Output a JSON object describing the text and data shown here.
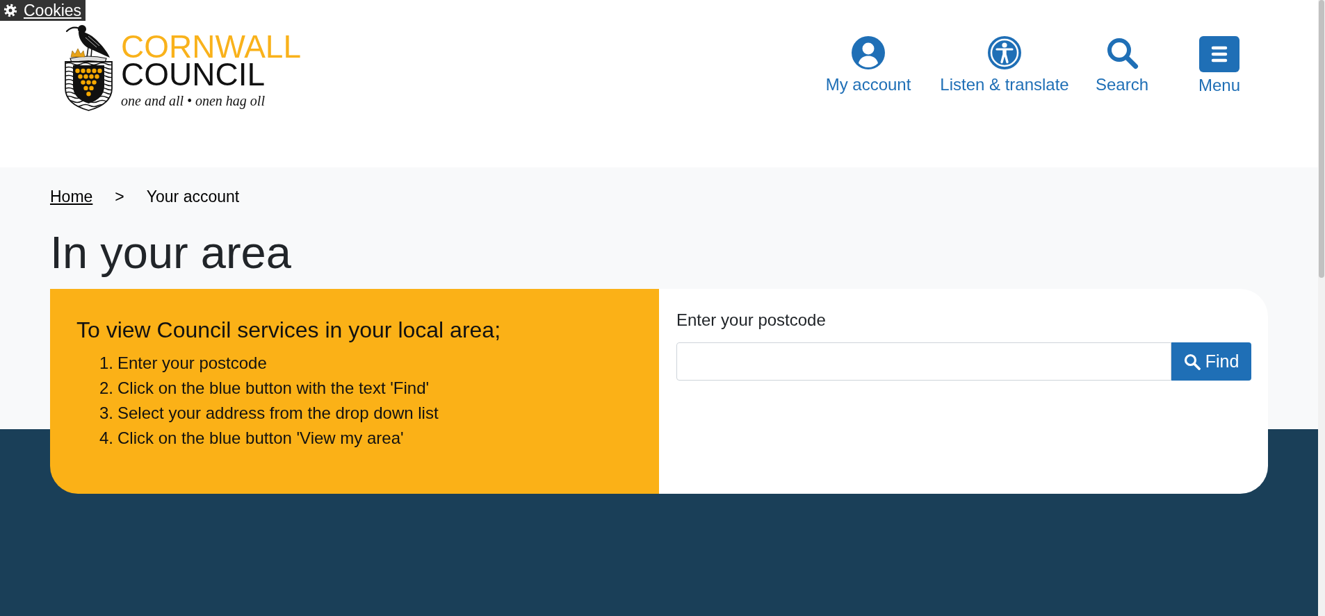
{
  "cookie_button": {
    "label": "Cookies"
  },
  "logo": {
    "line_1": "CORNWALL",
    "line_2": "COUNCIL",
    "motto": "one and all • onen hag oll"
  },
  "header_nav": [
    {
      "kind": "account",
      "label": "My account"
    },
    {
      "kind": "accessibility",
      "label": "Listen & translate"
    },
    {
      "kind": "search",
      "label": "Search"
    },
    {
      "kind": "menu",
      "label": "Menu"
    }
  ],
  "breadcrumb": {
    "separator": ">",
    "items": [
      {
        "label": "Home",
        "current": false
      },
      {
        "label": "Your account",
        "current": true
      }
    ]
  },
  "page_title": "In your area",
  "instructions": {
    "title": "To view Council services in your local area;",
    "steps": [
      {
        "number": "1.",
        "text": "Enter your postcode"
      },
      {
        "number": "2.",
        "text": "Click on the blue button with the text 'Find'"
      },
      {
        "number": "3.",
        "text": "Select your address from the drop down list"
      },
      {
        "number": "4.",
        "text": "Click on the blue button 'View my area'"
      }
    ]
  },
  "postcode_search": {
    "label": "Enter your postcode",
    "button": "Find"
  }
}
